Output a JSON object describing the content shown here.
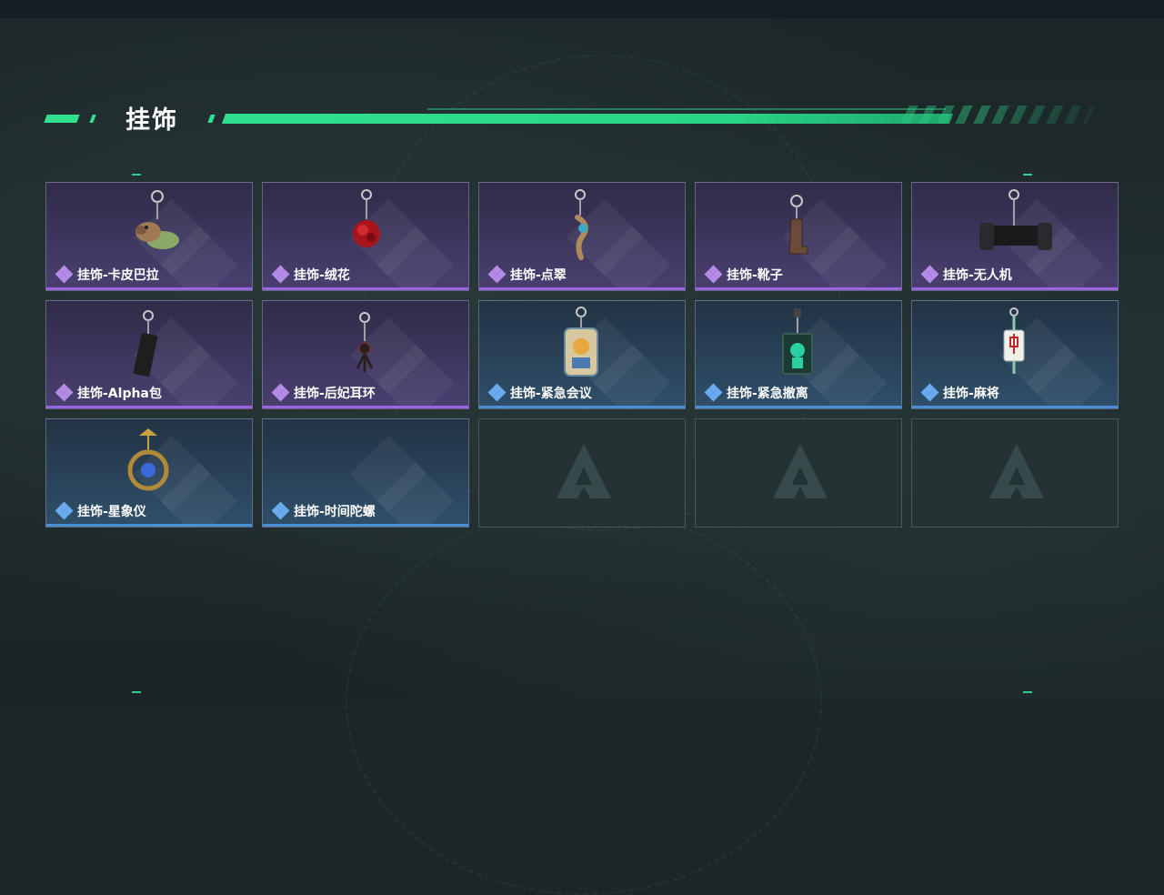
{
  "page": {
    "title": "挂饰"
  },
  "colors": {
    "accent": "#2ee08e",
    "rarity_purple": "#9a66e0",
    "rarity_blue": "#4a8fd6"
  },
  "items": [
    {
      "label": "挂饰-卡皮巴拉",
      "rarity": "purple",
      "icon": "capybara-charm-icon"
    },
    {
      "label": "挂饰-绒花",
      "rarity": "purple",
      "icon": "velvet-flower-charm-icon"
    },
    {
      "label": "挂饰-点翠",
      "rarity": "purple",
      "icon": "kingfisher-charm-icon"
    },
    {
      "label": "挂饰-靴子",
      "rarity": "purple",
      "icon": "boot-charm-icon"
    },
    {
      "label": "挂饰-无人机",
      "rarity": "purple",
      "icon": "drone-charm-icon"
    },
    {
      "label": "挂饰-Alpha包",
      "rarity": "purple",
      "icon": "alpha-bag-charm-icon"
    },
    {
      "label": "挂饰-后妃耳环",
      "rarity": "purple",
      "icon": "earring-charm-icon"
    },
    {
      "label": "挂饰-紧急会议",
      "rarity": "blue",
      "icon": "emergency-meeting-charm-icon"
    },
    {
      "label": "挂饰-紧急撤离",
      "rarity": "blue",
      "icon": "emergency-exit-charm-icon"
    },
    {
      "label": "挂饰-麻将",
      "rarity": "blue",
      "icon": "mahjong-charm-icon"
    },
    {
      "label": "挂饰-星象仪",
      "rarity": "blue",
      "icon": "astrolabe-charm-icon"
    },
    {
      "label": "挂饰-时间陀螺",
      "rarity": "blue",
      "icon": "time-gyroscope-charm-icon"
    }
  ],
  "empty_slots": 3
}
